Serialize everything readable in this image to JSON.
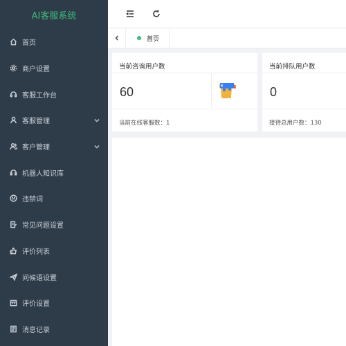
{
  "app": {
    "title": "AI客服系统"
  },
  "sidebar": {
    "items": [
      {
        "label": "首页",
        "icon": "home-icon",
        "has_arrow": false
      },
      {
        "label": "商户设置",
        "icon": "gear-icon",
        "has_arrow": false
      },
      {
        "label": "客服工作台",
        "icon": "headset-icon",
        "has_arrow": false
      },
      {
        "label": "客服管理",
        "icon": "user-icon",
        "has_arrow": true
      },
      {
        "label": "客户管理",
        "icon": "users-icon",
        "has_arrow": true
      },
      {
        "label": "机器人知识库",
        "icon": "robot-icon",
        "has_arrow": false
      },
      {
        "label": "违禁词",
        "icon": "smile-icon",
        "has_arrow": false
      },
      {
        "label": "常见问题设置",
        "icon": "edit-icon",
        "has_arrow": false
      },
      {
        "label": "评价列表",
        "icon": "thumb-icon",
        "has_arrow": false
      },
      {
        "label": "问候语设置",
        "icon": "send-icon",
        "has_arrow": false
      },
      {
        "label": "评价设置",
        "icon": "calendar-icon",
        "has_arrow": false
      },
      {
        "label": "消息记录",
        "icon": "document-icon",
        "has_arrow": false
      }
    ]
  },
  "header": {
    "collapse_icon": "menu-fold-icon",
    "refresh_icon": "refresh-icon"
  },
  "tabs": [
    {
      "label": "首页",
      "active": true
    }
  ],
  "cards": [
    {
      "title": "当前咨询用户数",
      "value": "60",
      "footer": "当前在线客服数：1",
      "icon": "cup-icon"
    },
    {
      "title": "当前排队用户数",
      "value": "0",
      "footer": "接待总用户数：130"
    }
  ],
  "colors": {
    "sidebar_bg": "#2e3b48",
    "logo_text": "#3fba7d",
    "active_dot": "#3fba7d"
  }
}
